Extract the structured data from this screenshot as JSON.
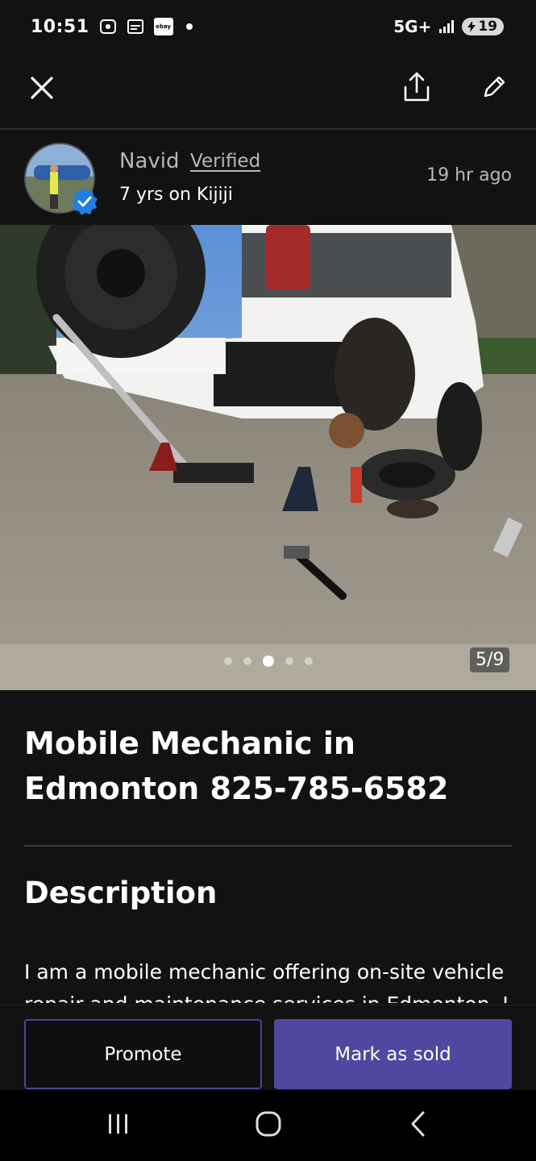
{
  "status_bar": {
    "time": "10:51",
    "ebay_label": "ebay",
    "network": "5G+",
    "battery": "19"
  },
  "top_bar": {
    "close_icon": "close-icon",
    "share_icon": "share-icon",
    "edit_icon": "pencil-icon"
  },
  "seller": {
    "name": "Navid",
    "verified_label": "Verified",
    "tenure": "7 yrs on Kijiji",
    "posted": "19 hr  ago"
  },
  "gallery": {
    "counter": "5/9",
    "dot_count": 5,
    "active_dot": 2
  },
  "listing": {
    "title": "Mobile Mechanic in Edmonton 825-785-6582",
    "description_heading": "Description",
    "description_text": "I am a mobile mechanic offering on-site vehicle repair and maintenance services in Edmonton. I"
  },
  "actions": {
    "promote_label": "Promote",
    "mark_sold_label": "Mark as sold"
  },
  "colors": {
    "background": "#121212",
    "accent": "#4f47a0",
    "verified_blue": "#1e7fe0"
  }
}
